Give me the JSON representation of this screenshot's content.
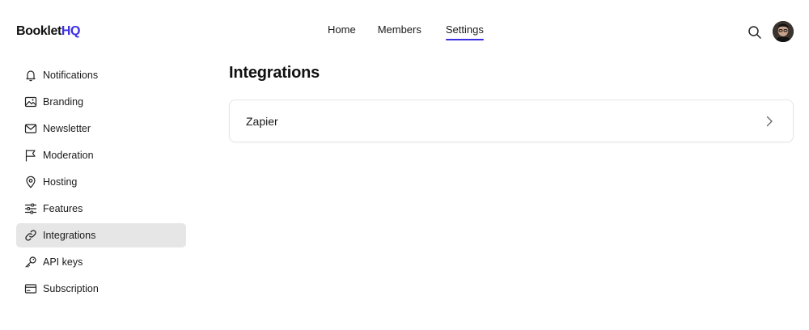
{
  "brand": {
    "name_main": "Booklet",
    "name_accent": "HQ",
    "accent_color": "#3b2fe0"
  },
  "nav": {
    "items": [
      {
        "label": "Home",
        "active": false
      },
      {
        "label": "Members",
        "active": false
      },
      {
        "label": "Settings",
        "active": true
      }
    ]
  },
  "header": {
    "search_icon": "search-icon",
    "avatar_icon": "user-avatar"
  },
  "sidebar": {
    "items": [
      {
        "label": "Notifications",
        "icon": "bell-icon",
        "active": false
      },
      {
        "label": "Branding",
        "icon": "image-icon",
        "active": false
      },
      {
        "label": "Newsletter",
        "icon": "mail-icon",
        "active": false
      },
      {
        "label": "Moderation",
        "icon": "flag-icon",
        "active": false
      },
      {
        "label": "Hosting",
        "icon": "location-pin-icon",
        "active": false
      },
      {
        "label": "Features",
        "icon": "sliders-icon",
        "active": false
      },
      {
        "label": "Integrations",
        "icon": "link-icon",
        "active": true
      },
      {
        "label": "API keys",
        "icon": "key-icon",
        "active": false
      },
      {
        "label": "Subscription",
        "icon": "credit-card-icon",
        "active": false
      }
    ]
  },
  "main": {
    "title": "Integrations",
    "integrations": [
      {
        "label": "Zapier",
        "icon": "chevron-right-icon"
      }
    ]
  }
}
